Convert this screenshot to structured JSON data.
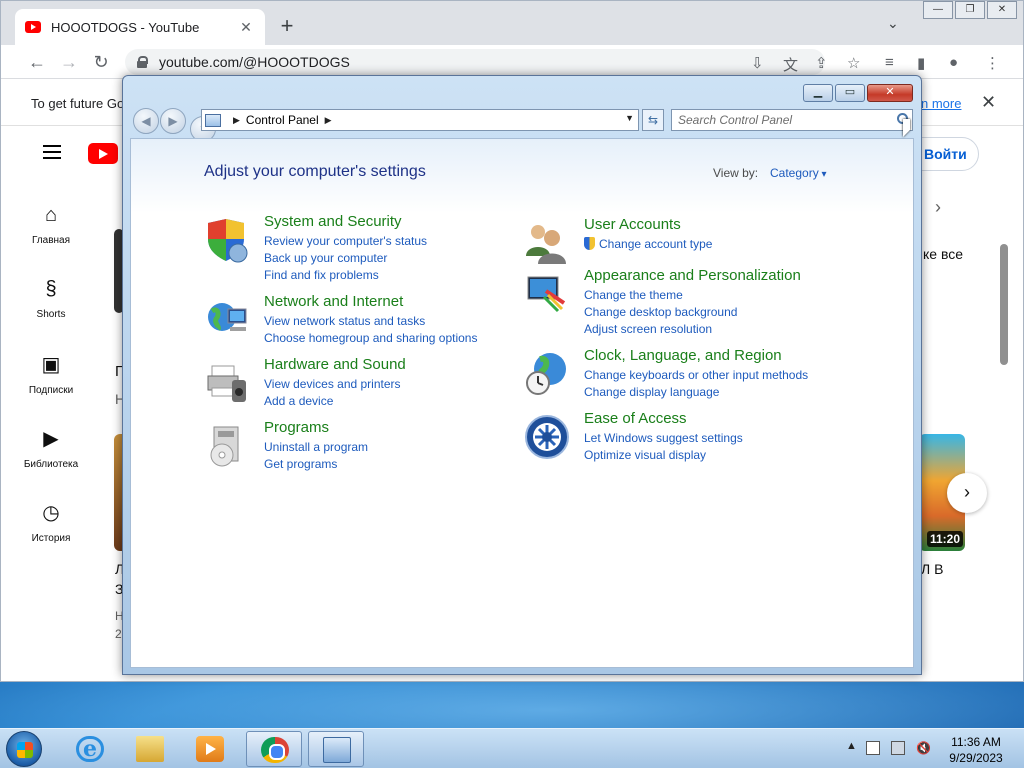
{
  "chrome": {
    "tab_title": "HOOOTDOGS - YouTube",
    "tab_close": "✕",
    "new_tab": "+",
    "tab_search": "⌄",
    "win_min": "—",
    "win_max": "❐",
    "win_close": "✕",
    "url": "youtube.com/@HOOOTDOGS",
    "banner_text": "To get future Go",
    "banner_link": "n more",
    "banner_close": "✕"
  },
  "youtube": {
    "signin": "Войти",
    "nav": [
      {
        "label": "Главная",
        "icon": "home-icon"
      },
      {
        "label": "Shorts",
        "icon": "shorts-icon"
      },
      {
        "label": "Подписки",
        "icon": "subscriptions-icon"
      },
      {
        "label": "Библиотека",
        "icon": "library-icon"
      },
      {
        "label": "История",
        "icon": "history-icon"
      }
    ],
    "fragments": {
      "right_text": "ке все",
      "left_p": "П",
      "left_h": "Н",
      "right_v": "Л В",
      "left_l": "Л",
      "left_3": "З",
      "left_h2": "Н",
      "left_20": "20"
    },
    "duration": "11:20",
    "chevron": "›"
  },
  "control_panel": {
    "breadcrumb": "Control Panel",
    "search_placeholder": "Search Control Panel",
    "heading": "Adjust your computer's settings",
    "view_by_label": "View by:",
    "view_by_value": "Category",
    "categories": [
      {
        "title": "System and Security",
        "icon": "shield-icon",
        "links": [
          "Review your computer's status",
          "Back up your computer",
          "Find and fix problems"
        ]
      },
      {
        "title": "Network and Internet",
        "icon": "network-globe-icon",
        "links": [
          "View network status and tasks",
          "Choose homegroup and sharing options"
        ]
      },
      {
        "title": "Hardware and Sound",
        "icon": "printer-icon",
        "links": [
          "View devices and printers",
          "Add a device"
        ]
      },
      {
        "title": "Programs",
        "icon": "programs-disc-icon",
        "links": [
          "Uninstall a program",
          "Get programs"
        ]
      },
      {
        "title": "User Accounts",
        "icon": "users-icon",
        "links": [
          "Change account type"
        ]
      },
      {
        "title": "Appearance and Personalization",
        "icon": "display-paint-icon",
        "links": [
          "Change the theme",
          "Change desktop background",
          "Adjust screen resolution"
        ]
      },
      {
        "title": "Clock, Language, and Region",
        "icon": "clock-globe-icon",
        "links": [
          "Change keyboards or other input methods",
          "Change display language"
        ]
      },
      {
        "title": "Ease of Access",
        "icon": "ease-of-access-icon",
        "links": [
          "Let Windows suggest settings",
          "Optimize visual display"
        ]
      }
    ]
  },
  "taskbar": {
    "time": "11:36 AM",
    "date": "9/29/2023"
  }
}
